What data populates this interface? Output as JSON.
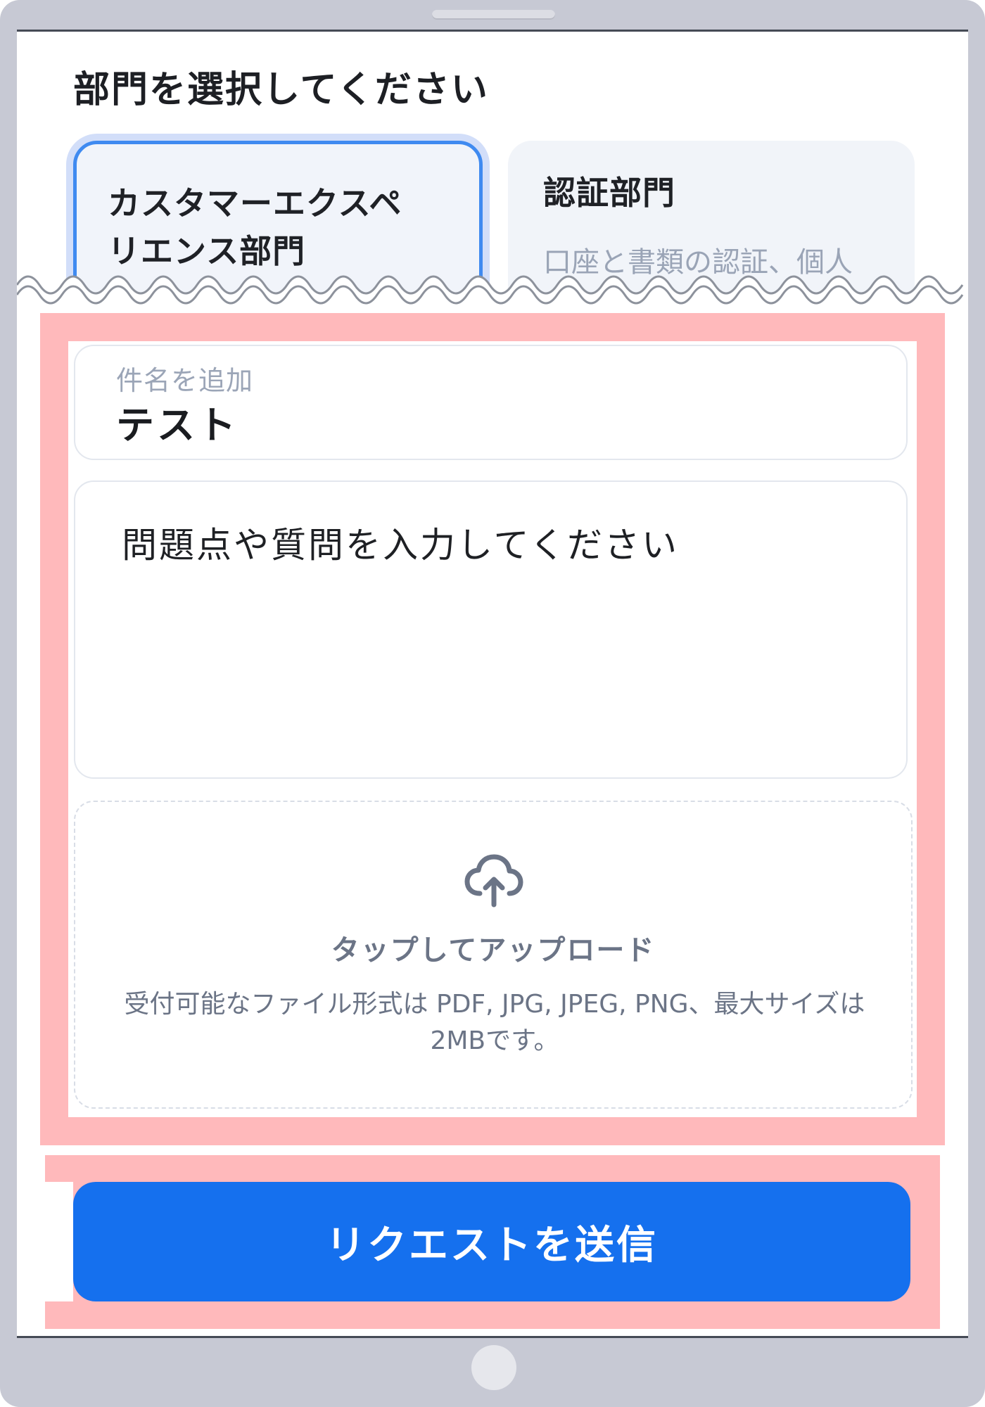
{
  "section": {
    "title": "部門を選択してください"
  },
  "departments": [
    {
      "name": "カスタマーエクスペリエンス部門",
      "name_line1": "カスタマーエクスペ",
      "name_line2": "リエンス部門",
      "selected": true
    },
    {
      "name": "認証部門",
      "description": "口座と書類の認証、個人",
      "selected": false
    }
  ],
  "form": {
    "subject": {
      "label": "件名を追加",
      "value": "テスト"
    },
    "message": {
      "placeholder": "問題点や質問を入力してください"
    },
    "upload": {
      "icon": "cloud-upload-icon",
      "title": "タップしてアップロード",
      "description": "受付可能なファイル形式は PDF, JPG, JPEG, PNG、最大サイズは2MBです。"
    }
  },
  "submit": {
    "label": "リクエストを送信"
  },
  "colors": {
    "accent": "#1570ee",
    "highlight": "#ffb9bb",
    "selected_border": "#3f8af0"
  }
}
